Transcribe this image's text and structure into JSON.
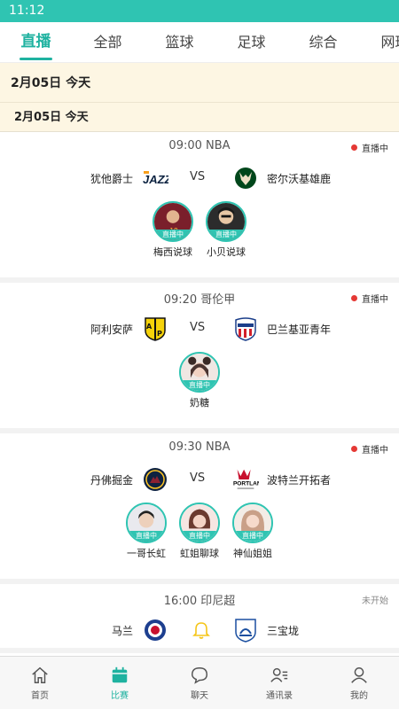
{
  "statusbar": {
    "time": "11:12"
  },
  "tabs": [
    {
      "label": "直播",
      "active": true
    },
    {
      "label": "全部"
    },
    {
      "label": "篮球"
    },
    {
      "label": "足球"
    },
    {
      "label": "综合"
    },
    {
      "label": "网球"
    }
  ],
  "date_header": {
    "big": "2月05日  今天",
    "small": "2月05日  今天"
  },
  "matches": [
    {
      "time": "09:00  NBA",
      "status": "直播中",
      "home": "犹他爵士",
      "away": "密尔沃基雄鹿",
      "vs": "VS",
      "anchors": [
        {
          "name": "梅西说球",
          "badge": "直播中"
        },
        {
          "name": "小贝说球",
          "badge": "直播中"
        }
      ]
    },
    {
      "time": "09:20  哥伦甲",
      "status": "直播中",
      "home": "阿利安萨",
      "away": "巴兰基亚青年",
      "vs": "VS",
      "anchors": [
        {
          "name": "奶糖",
          "badge": "直播中"
        }
      ]
    },
    {
      "time": "09:30  NBA",
      "status": "直播中",
      "home": "丹佛掘金",
      "away": "波特兰开拓者",
      "vs": "VS",
      "anchors": [
        {
          "name": "一哥长虹",
          "badge": "直播中"
        },
        {
          "name": "虹姐聊球",
          "badge": "直播中"
        },
        {
          "name": "神仙姐姐",
          "badge": "直播中"
        }
      ]
    },
    {
      "time": "16:00  印尼超",
      "status": "未开始",
      "home": "马兰",
      "away": "三宝垅"
    }
  ],
  "bottomnav": [
    {
      "label": "首页",
      "icon": "home-icon"
    },
    {
      "label": "比赛",
      "icon": "calendar-icon",
      "active": true
    },
    {
      "label": "聊天",
      "icon": "chat-icon"
    },
    {
      "label": "通讯录",
      "icon": "contacts-icon"
    },
    {
      "label": "我的",
      "icon": "profile-icon"
    }
  ],
  "colors": {
    "accent": "#1fb2a0",
    "statusbar": "#2fc4b2",
    "live_dot": "#e53935",
    "date_bg": "#fdf6e3"
  }
}
